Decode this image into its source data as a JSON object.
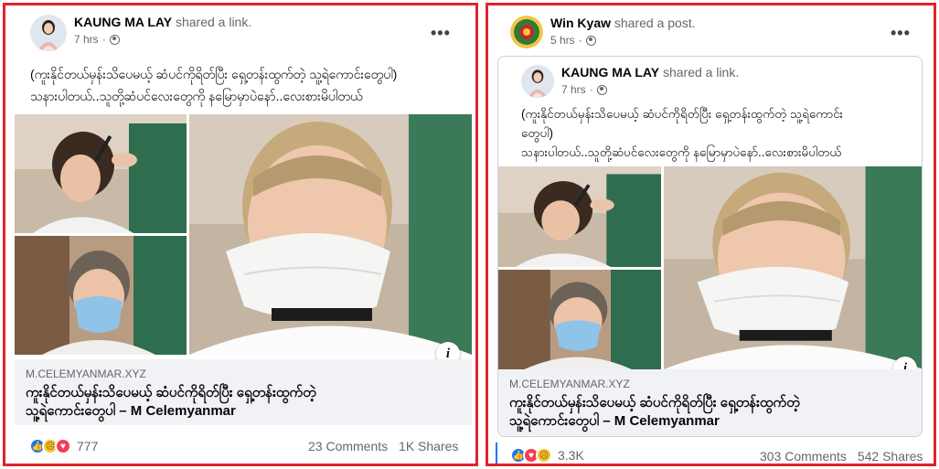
{
  "left_post": {
    "author": "KAUNG MA LAY",
    "action": "shared a link.",
    "time": "7 hrs",
    "more_label": "•••",
    "caption_line1": "(ကူးနိုင်တယ်မှန်းသိပေမယ့် ဆံပင်ကိုရိတ်ပြီး ရှေ့တန်းထွက်တဲ့ သူ့ရဲကောင်းတွေပါ)",
    "caption_line2": "သနားပါတယ်..သူတို့ဆံပင်လေးတွေကို နမြောမှာပဲနော်..လေးစားမိပါတယ်",
    "info_label": "i",
    "link_domain": "M.CELEMYANMAR.XYZ",
    "link_title_line1": "ကူးနိုင်တယ်မှန်းသိပေမယ့် ဆံပင်ကိုရိတ်ပြီး ရှေ့တန်းထွက်တဲ့",
    "link_title_line2": "သူ့ရဲကောင်းတွေပါ – M Celemyanmar",
    "reaction_count": "777",
    "comments": "23 Comments",
    "shares": "1K Shares"
  },
  "right_post": {
    "author": "Win Kyaw",
    "action": "shared a post.",
    "time": "5 hrs",
    "more_label": "•••",
    "shared": {
      "author": "KAUNG MA LAY",
      "action": "shared a link.",
      "time": "7 hrs",
      "caption_line1": "(ကူးနိုင်တယ်မှန်းသိပေမယ့် ဆံပင်ကိုရိတ်ပြီး ရှေ့တန်းထွက်တဲ့ သူ့ရဲကောင်း",
      "caption_line2": "တွေပါ)",
      "caption_line3": "သနားပါတယ်..သူတို့ဆံပင်လေးတွေကို နမြောမှာပဲနော်..လေးစားမိပါတယ်",
      "info_label": "i",
      "link_domain": "M.CELEMYANMAR.XYZ",
      "link_title_line1": "ကူးနိုင်တယ်မှန်းသိပေမယ့် ဆံပင်ကိုရိတ်ပြီး ရှေ့တန်းထွက်တဲ့",
      "link_title_line2": "သူ့ရဲကောင်းတွေပါ – M Celemyanmar"
    },
    "reaction_count": "3.3K",
    "comments": "303 Comments",
    "shares": "542 Shares"
  },
  "colors": {
    "frame_red": "#e0242c",
    "fb_blue": "#1877f2",
    "love_red": "#f33e58",
    "haha_yellow": "#f7c531",
    "link_bg": "#f0f2f5"
  },
  "icons": [
    "globe-icon",
    "more-icon",
    "info-icon",
    "like-icon",
    "love-icon",
    "haha-icon"
  ]
}
